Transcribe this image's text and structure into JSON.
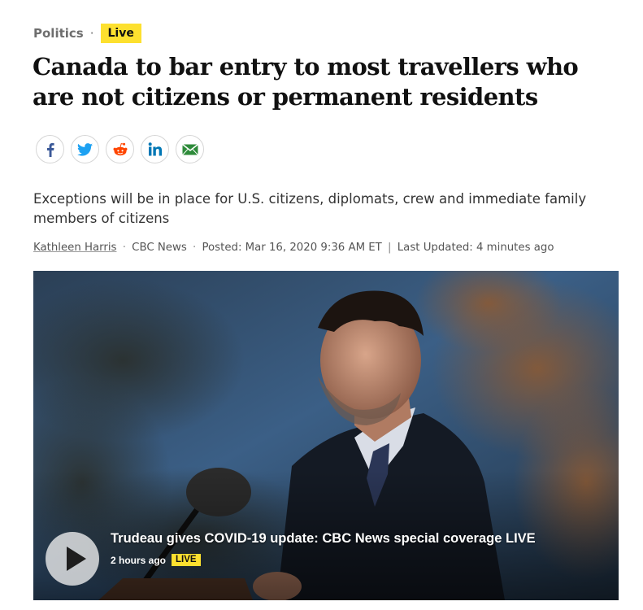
{
  "kicker": {
    "section": "Politics",
    "separator": "·",
    "live_label": "Live"
  },
  "headline": "Canada to bar entry to most travellers who are not citizens or permanent residents",
  "share": [
    {
      "name": "facebook-share",
      "icon": "facebook-icon"
    },
    {
      "name": "twitter-share",
      "icon": "twitter-icon"
    },
    {
      "name": "reddit-share",
      "icon": "reddit-icon"
    },
    {
      "name": "linkedin-share",
      "icon": "linkedin-icon"
    },
    {
      "name": "email-share",
      "icon": "email-icon"
    }
  ],
  "deck": "Exceptions will be in place for U.S. citizens, diplomats, crew and immediate family members of citizens",
  "byline": {
    "author": "Kathleen Harris",
    "source": "CBC News",
    "posted": "Posted: Mar 16, 2020 9:36 AM ET",
    "divider": "|",
    "updated": "Last Updated: 4 minutes ago"
  },
  "video": {
    "title": "Trudeau gives COVID-19 update: CBC News special coverage LIVE",
    "time_ago": "2 hours ago",
    "live_label": "LIVE"
  },
  "colors": {
    "live_badge": "#fde02f",
    "facebook": "#3b5998",
    "twitter": "#1da1f2",
    "reddit": "#ff4500",
    "linkedin": "#0077b5",
    "email": "#2e8b3a"
  }
}
